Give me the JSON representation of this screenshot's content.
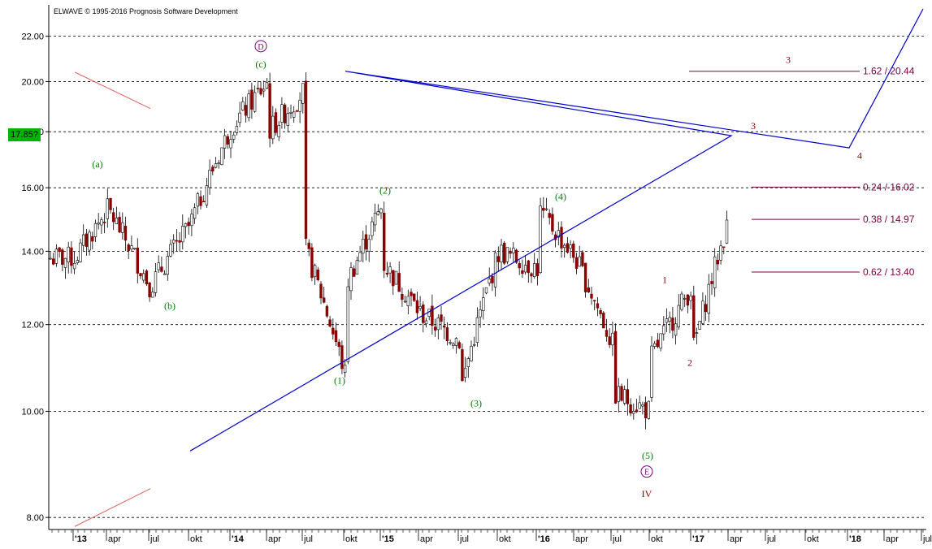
{
  "header": {
    "copyright": "ELWAVE © 1995-2016 Prognosis Software Development",
    "last_price": "17.85?"
  },
  "chart_data": {
    "type": "candlestick",
    "y_scale": "log",
    "ylim": [
      7.8,
      23.5
    ],
    "y_ticks": [
      {
        "value": 8,
        "label": "8.00"
      },
      {
        "value": 10,
        "label": "10.00"
      },
      {
        "value": 12,
        "label": "12.00"
      },
      {
        "value": 14,
        "label": "14.00"
      },
      {
        "value": 16,
        "label": "16.00"
      },
      {
        "value": 18,
        "label": "18.00"
      },
      {
        "value": 20,
        "label": "20.00"
      },
      {
        "value": 22,
        "label": "22.00"
      }
    ],
    "x_ticks": [
      "'13",
      "apr",
      "jul",
      "okt",
      "'14",
      "apr",
      "jul",
      "okt",
      "'15",
      "apr",
      "jul",
      "okt",
      "'16",
      "apr",
      "jul",
      "okt",
      "'17",
      "apr",
      "jul",
      "okt",
      "'18",
      "apr",
      "jul"
    ],
    "price_path": [
      [
        "'13",
        12.0
      ],
      [
        "'13",
        13.8
      ],
      [
        "apr",
        15.3
      ],
      [
        "jul",
        13.0
      ],
      [
        "okt",
        14.8
      ],
      [
        "'14",
        18.2
      ],
      [
        "apr",
        20.0
      ],
      [
        "apr",
        18.0
      ],
      [
        "jul",
        19.6
      ],
      [
        "jul",
        14.2
      ],
      [
        "okt",
        10.8
      ],
      [
        "okt",
        13.0
      ],
      [
        "'15",
        15.4
      ],
      [
        "'15",
        13.7
      ],
      [
        "apr",
        12.3
      ],
      [
        "jul",
        11.6
      ],
      [
        "jul",
        10.4
      ],
      [
        "okt",
        14.0
      ],
      [
        "'16",
        13.5
      ],
      [
        "'16",
        15.3
      ],
      [
        "apr",
        13.8
      ],
      [
        "jul",
        11.5
      ],
      [
        "jul",
        10.4
      ],
      [
        "okt",
        10.0
      ],
      [
        "okt",
        9.2
      ],
      [
        "okt",
        11.2
      ],
      [
        "'17",
        13.0
      ],
      [
        "'17",
        11.3
      ],
      [
        "apr",
        15.0
      ],
      [
        "apr",
        17.85
      ]
    ],
    "wave_labels": [
      {
        "label": "(a)",
        "color": "green",
        "at": [
          "apr",
          16.7
        ]
      },
      {
        "label": "(b)",
        "color": "green",
        "at": [
          "jul",
          12.4
        ]
      },
      {
        "label": "(c)",
        "color": "green",
        "at": [
          "apr",
          20.6
        ]
      },
      {
        "label": "D",
        "color": "purple",
        "circled": true,
        "at": [
          "apr",
          21.4
        ]
      },
      {
        "label": "(1)",
        "color": "green",
        "at": [
          "okt",
          10.6
        ]
      },
      {
        "label": "(2)",
        "color": "green",
        "at": [
          "'15",
          15.8
        ]
      },
      {
        "label": "(3)",
        "color": "green",
        "at": [
          "jul",
          10.1
        ]
      },
      {
        "label": "(4)",
        "color": "green",
        "at": [
          "'16",
          15.6
        ]
      },
      {
        "label": "(5)",
        "color": "green",
        "at": [
          "okt",
          9.05
        ]
      },
      {
        "label": "E",
        "color": "purple",
        "circled": true,
        "at": [
          "okt",
          8.75
        ]
      },
      {
        "label": "IV",
        "color": "darkred",
        "at": [
          "okt",
          8.35
        ]
      },
      {
        "label": "1",
        "color": "darkred",
        "at": [
          "okt",
          13.1
        ]
      },
      {
        "label": "2",
        "color": "darkred",
        "at": [
          "'17",
          11.0
        ]
      },
      {
        "label": "3",
        "color": "darkred",
        "at": [
          "apr",
          18.1
        ]
      },
      {
        "label": "3",
        "color": "darkred",
        "at": [
          "okt",
          20.8
        ]
      },
      {
        "label": "4",
        "color": "darkred",
        "at": [
          "'18",
          17.0
        ]
      }
    ],
    "fib_targets": [
      {
        "label": "1.62 / 20.44",
        "value": 20.44
      },
      {
        "label": "0.24 / 16.02",
        "value": 16.02
      },
      {
        "label": "0.38 / 14.97",
        "value": 14.97
      },
      {
        "label": "0.62 / 13.40",
        "value": 13.4
      }
    ],
    "trendlines": [
      {
        "name": "upper channel",
        "from": [
          "'13",
          20.4
        ],
        "to": [
          "jul",
          18.9
        ]
      },
      {
        "name": "lower channel",
        "from": [
          "'13",
          7.85
        ],
        "to": [
          "jul",
          8.5
        ]
      }
    ],
    "projection": [
      [
        "okt",
        9.2
      ],
      [
        "apr",
        17.85
      ],
      [
        "okt",
        20.44
      ],
      [
        "'18",
        17.4
      ],
      [
        "jul",
        23.3
      ]
    ],
    "colors": {
      "up": "#000000",
      "down": "#8b0000",
      "wave_green": "#008000",
      "wave_purple": "#800080",
      "wave_red": "#8b0000",
      "fib": "#800040",
      "trend": "#e06060",
      "projection": "#0000cc",
      "price_badge": "#00b400"
    }
  }
}
